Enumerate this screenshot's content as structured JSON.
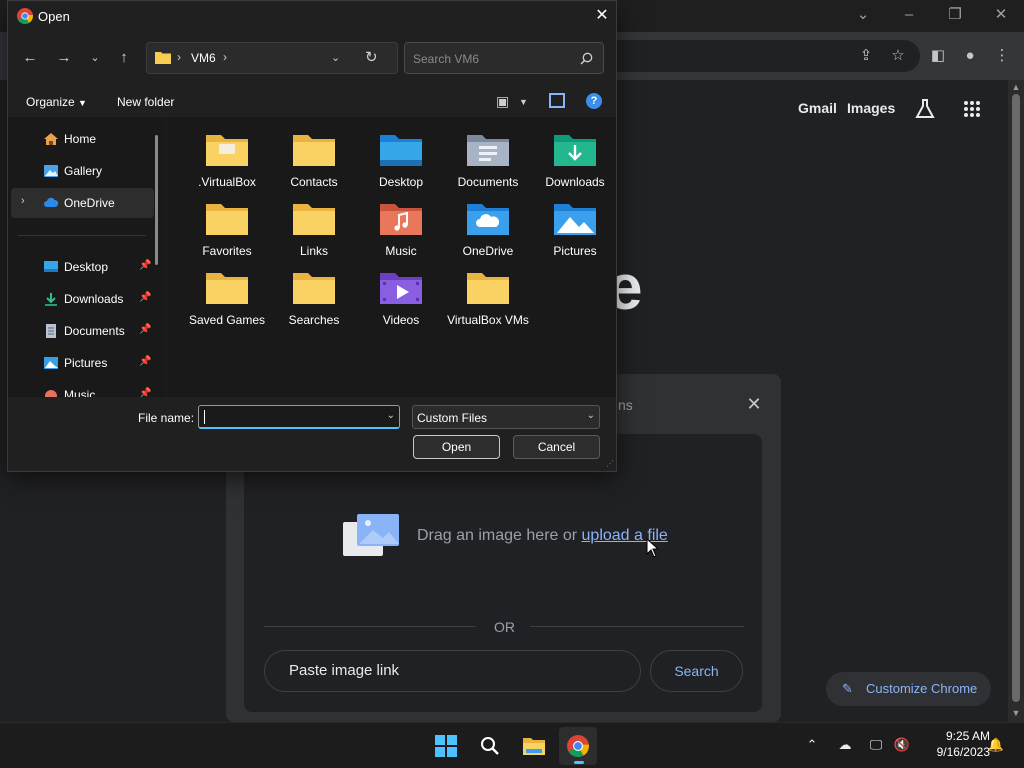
{
  "chrome": {
    "header_links": {
      "gmail": "Gmail",
      "images": "Images"
    },
    "logo_fragment": "e",
    "lens": {
      "title_fragment": "ns",
      "drag_text": "Drag an image here or ",
      "upload_link": "upload a file",
      "or_text": "OR",
      "paste_placeholder": "Paste image link",
      "search_label": "Search"
    },
    "customize_label": "Customize Chrome"
  },
  "dialog": {
    "title": "Open",
    "address_path": "VM6",
    "search_placeholder": "Search VM6",
    "toolbar": {
      "organize": "Organize",
      "new_folder": "New folder"
    },
    "nav_pane": {
      "top_items": [
        {
          "label": "Home",
          "icon": "home-icon"
        },
        {
          "label": "Gallery",
          "icon": "gallery-icon"
        },
        {
          "label": "OneDrive",
          "icon": "cloud-icon",
          "selected": true
        }
      ],
      "quick_access": [
        {
          "label": "Desktop",
          "icon": "desktop-icon",
          "pinned": true
        },
        {
          "label": "Downloads",
          "icon": "download-icon",
          "pinned": true
        },
        {
          "label": "Documents",
          "icon": "documents-icon",
          "pinned": true
        },
        {
          "label": "Pictures",
          "icon": "pictures-icon",
          "pinned": true
        },
        {
          "label": "Music",
          "icon": "music-icon",
          "pinned": true
        }
      ]
    },
    "files": [
      {
        "label": ".VirtualBox",
        "icon": "folder-icon"
      },
      {
        "label": "Contacts",
        "icon": "folder-icon"
      },
      {
        "label": "Desktop",
        "icon": "desktop-folder-icon"
      },
      {
        "label": "Documents",
        "icon": "documents-folder-icon"
      },
      {
        "label": "Downloads",
        "icon": "downloads-folder-icon"
      },
      {
        "label": "Favorites",
        "icon": "folder-icon"
      },
      {
        "label": "Links",
        "icon": "folder-icon"
      },
      {
        "label": "Music",
        "icon": "music-folder-icon"
      },
      {
        "label": "OneDrive",
        "icon": "onedrive-folder-icon"
      },
      {
        "label": "Pictures",
        "icon": "pictures-folder-icon"
      },
      {
        "label": "Saved Games",
        "icon": "folder-icon"
      },
      {
        "label": "Searches",
        "icon": "folder-icon"
      },
      {
        "label": "Videos",
        "icon": "videos-folder-icon"
      },
      {
        "label": "VirtualBox VMs",
        "icon": "folder-icon"
      }
    ],
    "footer": {
      "filename_label": "File name:",
      "filename_value": "",
      "filetype_value": "Custom Files",
      "open_label": "Open",
      "cancel_label": "Cancel"
    }
  },
  "taskbar": {
    "apps": [
      "start-icon",
      "search-icon",
      "file-explorer-icon",
      "chrome-icon"
    ],
    "time": "9:25 AM",
    "date": "9/16/2023"
  },
  "colors": {
    "accent_blue": "#4cc2ff",
    "chrome_link": "#8ab4f8",
    "folder_yellow": "#f8cc50"
  }
}
